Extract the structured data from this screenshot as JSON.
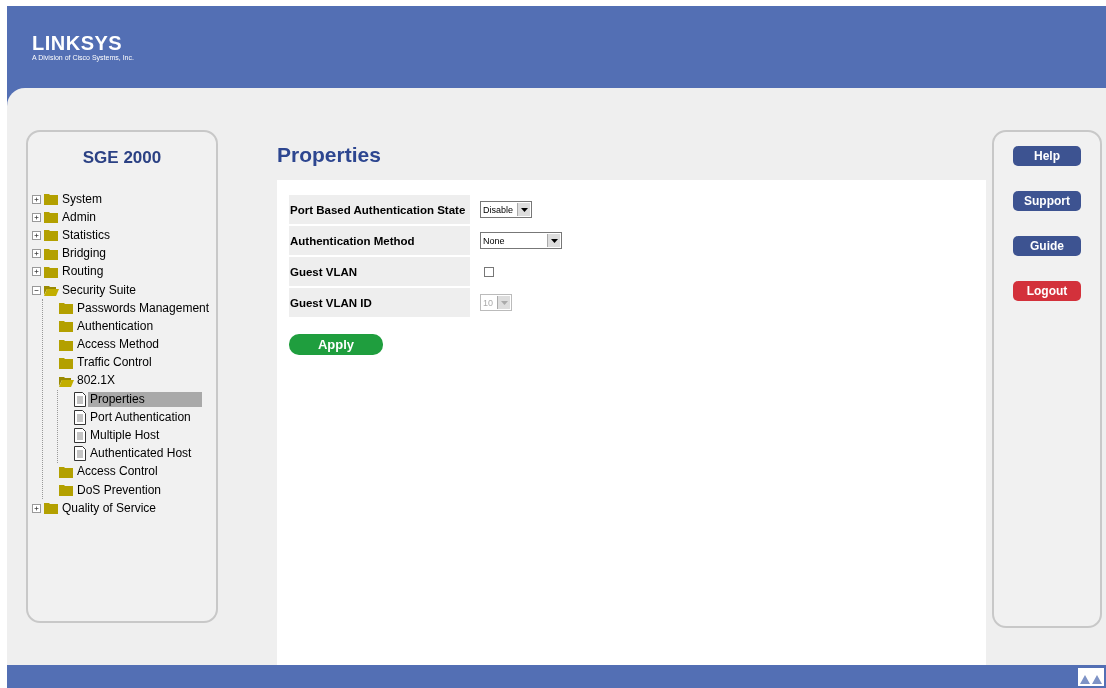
{
  "header": {
    "logo": "LINKSYS",
    "tagline": "A Division of Cisco Systems, Inc."
  },
  "sidebar": {
    "title": "SGE 2000",
    "tree": [
      {
        "label": "System",
        "kind": "folder",
        "expanded": false,
        "selected": false
      },
      {
        "label": "Admin",
        "kind": "folder",
        "expanded": false,
        "selected": false
      },
      {
        "label": "Statistics",
        "kind": "folder",
        "expanded": false,
        "selected": false
      },
      {
        "label": "Bridging",
        "kind": "folder",
        "expanded": false,
        "selected": false
      },
      {
        "label": "Routing",
        "kind": "folder",
        "expanded": false,
        "selected": false
      },
      {
        "label": "Security Suite",
        "kind": "folder",
        "expanded": true,
        "selected": false,
        "children": [
          {
            "label": "Passwords Management",
            "kind": "folder",
            "selected": false
          },
          {
            "label": "Authentication",
            "kind": "folder",
            "selected": false
          },
          {
            "label": "Access Method",
            "kind": "folder",
            "selected": false
          },
          {
            "label": "Traffic Control",
            "kind": "folder",
            "selected": false
          },
          {
            "label": "802.1X",
            "kind": "folder",
            "expanded": true,
            "selected": false,
            "children": [
              {
                "label": "Properties",
                "kind": "page",
                "selected": true
              },
              {
                "label": "Port Authentication",
                "kind": "page",
                "selected": false
              },
              {
                "label": "Multiple Host",
                "kind": "page",
                "selected": false
              },
              {
                "label": "Authenticated Host",
                "kind": "page",
                "selected": false
              }
            ]
          },
          {
            "label": "Access Control",
            "kind": "folder",
            "selected": false
          },
          {
            "label": "DoS Prevention",
            "kind": "folder",
            "selected": false
          }
        ]
      },
      {
        "label": "Quality of Service",
        "kind": "folder",
        "expanded": false,
        "selected": false
      }
    ]
  },
  "page_title": "Properties",
  "form": [
    {
      "label": "Port Based Authentication State",
      "kind": "select",
      "value": "Disable",
      "disabled": false
    },
    {
      "label": "Authentication Method",
      "kind": "select",
      "value": "None",
      "disabled": false
    },
    {
      "label": "Guest VLAN",
      "kind": "checkbox",
      "checked": false
    },
    {
      "label": "Guest VLAN ID",
      "kind": "select",
      "value": "10",
      "disabled": true
    }
  ],
  "apply_button": "Apply",
  "side_buttons": [
    {
      "label": "Help",
      "kind": "normal"
    },
    {
      "label": "Support",
      "kind": "normal"
    },
    {
      "label": "Guide",
      "kind": "normal"
    },
    {
      "label": "Logout",
      "kind": "danger"
    }
  ]
}
